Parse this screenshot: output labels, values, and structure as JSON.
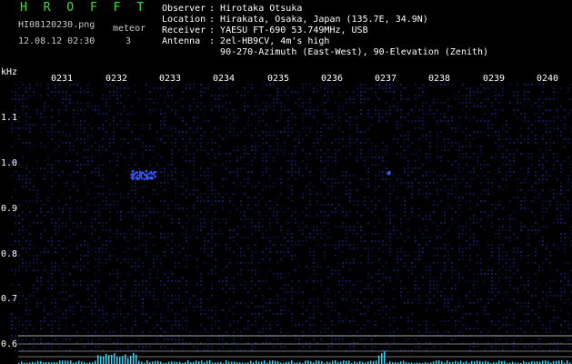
{
  "app": {
    "brand": "H R O F F T",
    "filename": "HI08120230.png",
    "datetime": "12.08.12 02:30",
    "meteor_label": "meteor",
    "meteor_count": "3"
  },
  "info": {
    "observer_key": "Observer",
    "observer": "Hirotaka Otsuka",
    "location_key": "Location",
    "location": "Hirakata, Osaka, Japan (135.7E, 34.9N)",
    "receiver_key": "Receiver",
    "receiver": "YAESU FT-690 53.749MHz, USB",
    "antenna_key": "Antenna",
    "antenna_line1": "2el-HB9CV, 4m's high",
    "antenna_line2": "90-270-Azimuth (East-West), 90-Elevation (Zenith)"
  },
  "axes": {
    "freq_unit": "kHz",
    "time_ticks": [
      "0231",
      "0232",
      "0233",
      "0234",
      "0235",
      "0236",
      "0237",
      "0238",
      "0239",
      "0240"
    ],
    "freq_ticks": [
      "1.1",
      "1.0",
      "0.9",
      "0.8",
      "0.7",
      "0.6"
    ]
  },
  "colors": {
    "background": "#000000",
    "brand": "#2ee82e",
    "text": "#ffffff",
    "noise": "#1a2a9a",
    "echo": "#3a5aff",
    "bottom_trace": "#38d8ff",
    "reference_line": "#c0c0c0"
  },
  "detections": [
    {
      "time_min": 2.3,
      "freq_khz_min": 0.965,
      "freq_khz_max": 0.985,
      "duration_min": 0.45
    },
    {
      "time_min": 7.05,
      "freq_khz_min": 0.975,
      "freq_khz_max": 0.982,
      "duration_min": 0.05
    }
  ]
}
